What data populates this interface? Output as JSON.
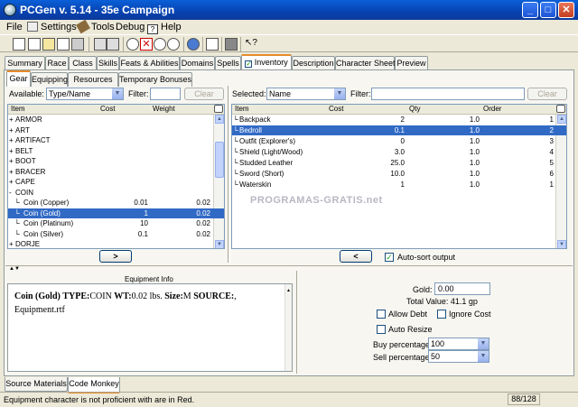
{
  "window": {
    "title": "PCGen v. 5.14 - 35e Campaign"
  },
  "menubar": [
    "File",
    "Settings",
    "Tools",
    "Debug",
    "Help"
  ],
  "main_tabs": [
    "Summary",
    "Race",
    "Class",
    "Skills",
    "Feats & Abilities",
    "Domains",
    "Spells",
    "Inventory",
    "Description",
    "Character Sheet",
    "Preview"
  ],
  "active_main_tab": "Inventory",
  "sub_tabs": [
    "Gear",
    "Equipping",
    "Resources",
    "Temporary Bonuses"
  ],
  "active_sub_tab": "Gear",
  "available": {
    "label": "Available:",
    "view": "Type/Name",
    "filter_label": "Filter:",
    "filter_value": "",
    "clear_label": "Clear",
    "columns": [
      "Item",
      "Cost",
      "Weight"
    ],
    "rows": [
      {
        "item": "ARMOR",
        "cost": "",
        "weight": "",
        "prefix": "+",
        "indent": 0,
        "selected": false
      },
      {
        "item": "ART",
        "cost": "",
        "weight": "",
        "prefix": "+",
        "indent": 0,
        "selected": false
      },
      {
        "item": "ARTIFACT",
        "cost": "",
        "weight": "",
        "prefix": "+",
        "indent": 0,
        "selected": false
      },
      {
        "item": "BELT",
        "cost": "",
        "weight": "",
        "prefix": "+",
        "indent": 0,
        "selected": false
      },
      {
        "item": "BOOT",
        "cost": "",
        "weight": "",
        "prefix": "+",
        "indent": 0,
        "selected": false
      },
      {
        "item": "BRACER",
        "cost": "",
        "weight": "",
        "prefix": "+",
        "indent": 0,
        "selected": false
      },
      {
        "item": "CAPE",
        "cost": "",
        "weight": "",
        "prefix": "+",
        "indent": 0,
        "selected": false
      },
      {
        "item": "COIN",
        "cost": "",
        "weight": "",
        "prefix": "-",
        "indent": 0,
        "selected": false
      },
      {
        "item": "Coin (Copper)",
        "cost": "0.01",
        "weight": "0.02",
        "prefix": "",
        "indent": 1,
        "selected": false
      },
      {
        "item": "Coin (Gold)",
        "cost": "1",
        "weight": "0.02",
        "prefix": "",
        "indent": 1,
        "selected": true
      },
      {
        "item": "Coin (Platinum)",
        "cost": "10",
        "weight": "0.02",
        "prefix": "",
        "indent": 1,
        "selected": false
      },
      {
        "item": "Coin (Silver)",
        "cost": "0.1",
        "weight": "0.02",
        "prefix": "",
        "indent": 1,
        "selected": false
      },
      {
        "item": "DORJE",
        "cost": "",
        "weight": "",
        "prefix": "+",
        "indent": 0,
        "selected": false
      }
    ],
    "add_button": ">"
  },
  "selected": {
    "label": "Selected:",
    "view": "Name",
    "filter_label": "Filter:",
    "filter_value": "",
    "clear_label": "Clear",
    "columns": [
      "Item",
      "Cost",
      "Qty",
      "Order"
    ],
    "rows": [
      {
        "item": "Backpack",
        "cost": "2",
        "qty": "1.0",
        "order": "1",
        "selected": false
      },
      {
        "item": "Bedroll",
        "cost": "0.1",
        "qty": "1.0",
        "order": "2",
        "selected": true
      },
      {
        "item": "Outfit (Explorer's)",
        "cost": "0",
        "qty": "1.0",
        "order": "3",
        "selected": false
      },
      {
        "item": "Shield (Light/Wood)",
        "cost": "3.0",
        "qty": "1.0",
        "order": "4",
        "selected": false
      },
      {
        "item": "Studded Leather",
        "cost": "25.0",
        "qty": "1.0",
        "order": "5",
        "selected": false
      },
      {
        "item": "Sword (Short)",
        "cost": "10.0",
        "qty": "1.0",
        "order": "6",
        "selected": false
      },
      {
        "item": "Waterskin",
        "cost": "1",
        "qty": "1.0",
        "order": "1",
        "selected": false
      }
    ],
    "remove_button": "<",
    "auto_sort_label": "Auto-sort output",
    "auto_sort_checked": true
  },
  "watermark": "PROGRAMAS-GRATIS.net",
  "equipment_info": {
    "title": "Equipment Info",
    "name": "Coin (Gold)",
    "type_label": "TYPE:",
    "type_value": "COIN",
    "wt_label": "WT:",
    "wt_value": "0.02 lbs.",
    "size_label": "Size:",
    "size_value": "M",
    "source_label": "SOURCE:",
    "source_value": ",",
    "source_file": "Equipment.rtf"
  },
  "gold_panel": {
    "gold_label": "Gold:",
    "gold_value": "0.00",
    "total_value_label": "Total Value:",
    "total_value": "41.1 gp",
    "allow_debt_label": "Allow Debt",
    "ignore_cost_label": "Ignore Cost",
    "auto_resize_label": "Auto Resize",
    "buy_pct_label": "Buy percentage:",
    "buy_pct_value": "100",
    "sell_pct_label": "Sell percentage:",
    "sell_pct_value": "50"
  },
  "bottom_tabs": [
    "Source Materials",
    "Code Monkey"
  ],
  "active_bottom_tab": "Code Monkey",
  "status": {
    "message": "Equipment character is not proficient with are in Red.",
    "memory": "88/128"
  },
  "colors": {
    "title_bar": "#0a4fd0",
    "selection": "#316ac5",
    "active_tab_accent": "#e68b2c"
  }
}
